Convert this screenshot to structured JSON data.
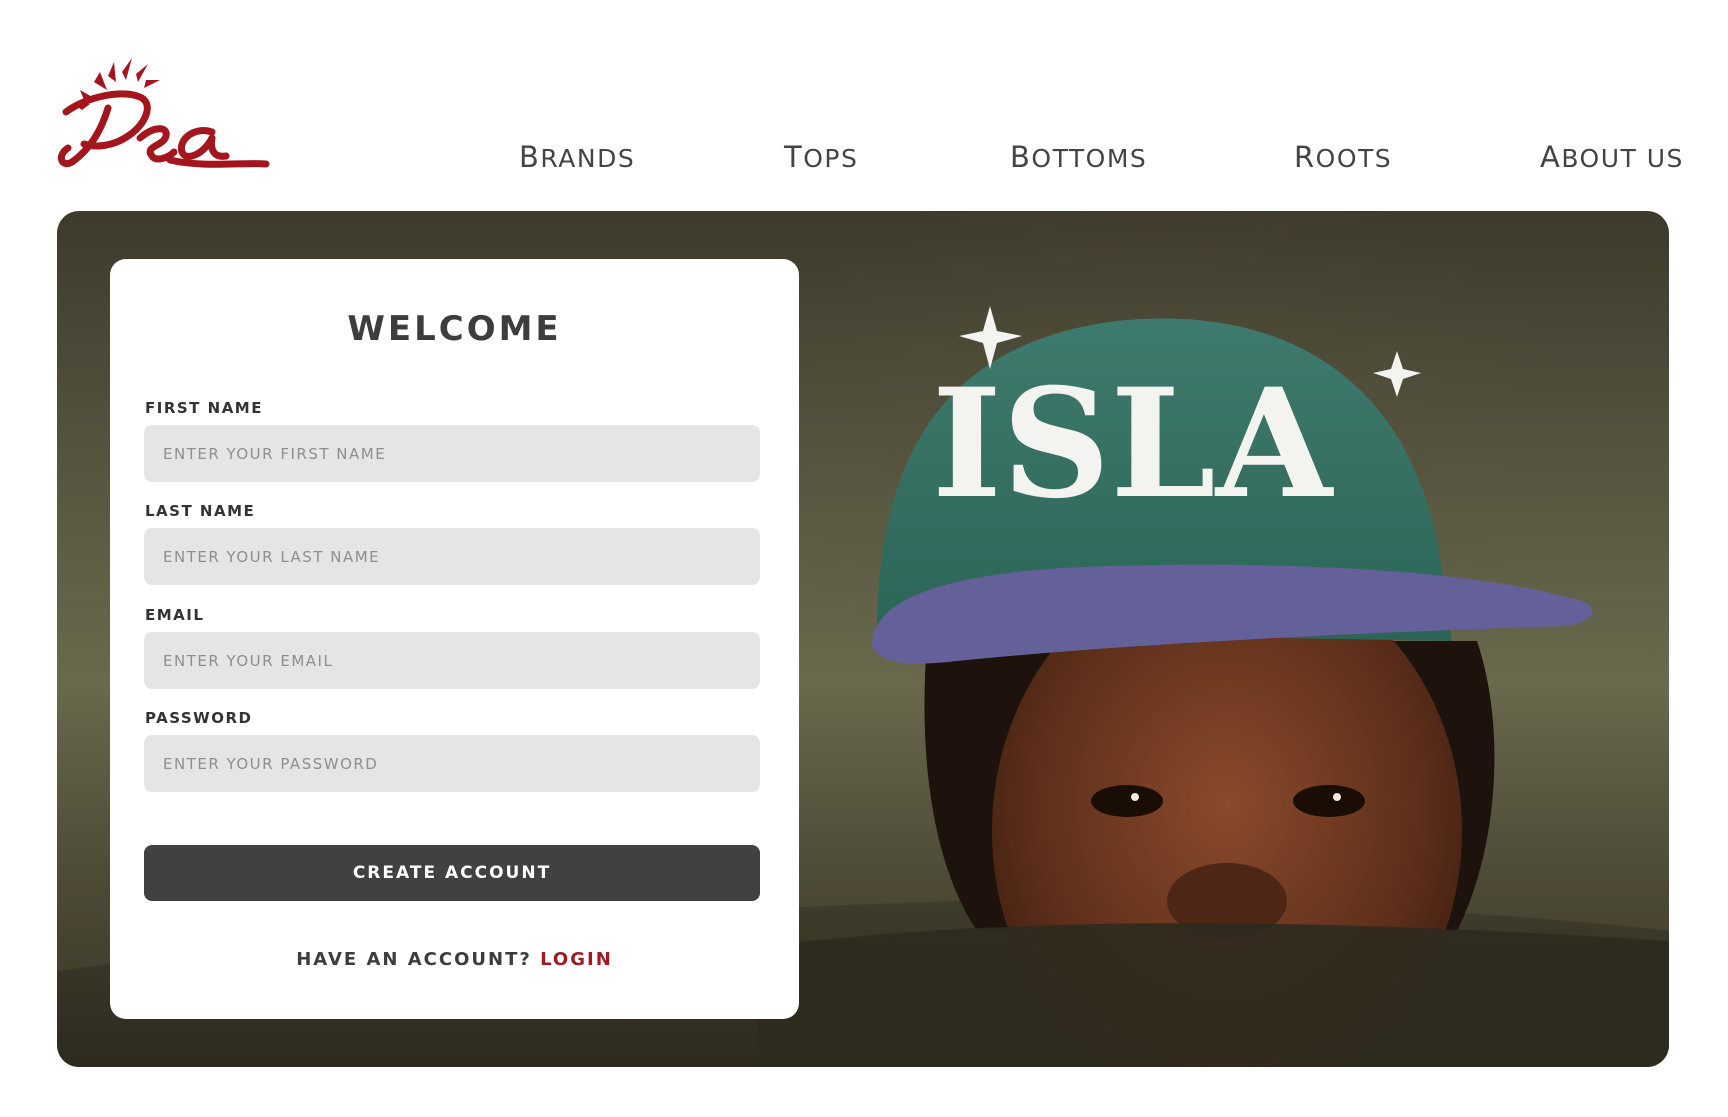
{
  "brand": {
    "logo_text": "Isa",
    "logo_color": "#a3161d"
  },
  "nav": {
    "items": [
      {
        "label": "Brands"
      },
      {
        "label": "Tops"
      },
      {
        "label": "Bottoms"
      },
      {
        "label": "Roots"
      },
      {
        "label": "About Us"
      }
    ]
  },
  "hero": {
    "cap_text": "ISLA"
  },
  "form": {
    "title": "WELCOME",
    "first_name": {
      "label": "FIRST NAME",
      "placeholder": "ENTER YOUR FIRST NAME",
      "value": ""
    },
    "last_name": {
      "label": "LAST NAME",
      "placeholder": "ENTER YOUR LAST NAME",
      "value": ""
    },
    "email": {
      "label": "EMAIL",
      "placeholder": "ENTER YOUR EMAIL",
      "value": ""
    },
    "password": {
      "label": "PASSWORD",
      "placeholder": "ENTER YOUR PASSWORD",
      "value": ""
    },
    "submit_label": "CREATE ACCOUNT",
    "have_account_text": "HAVE AN ACCOUNT?",
    "login_label": "LOGIN"
  },
  "colors": {
    "accent": "#9e1b22",
    "button": "#414141",
    "input_bg": "#e5e5e5"
  }
}
